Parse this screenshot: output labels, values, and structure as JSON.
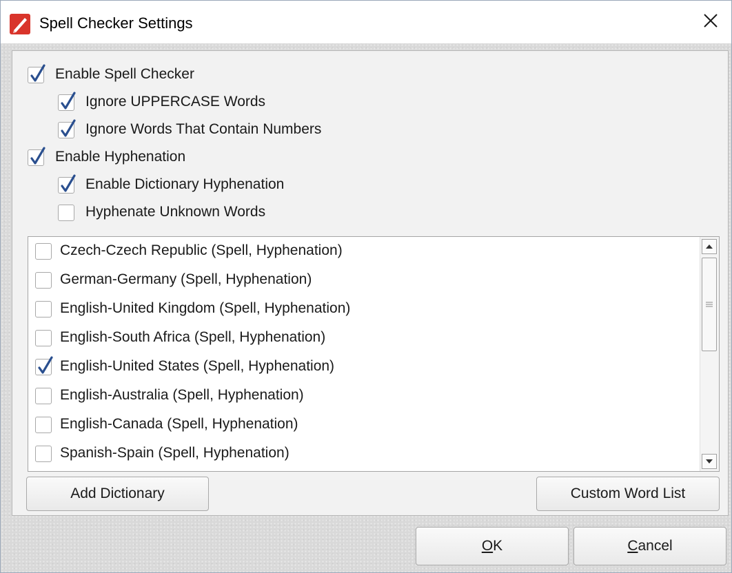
{
  "window": {
    "title": "Spell Checker Settings",
    "app_icon": "pdf-pen-icon",
    "close_icon": "close-icon"
  },
  "options": [
    {
      "label": "Enable Spell Checker",
      "checked": true
    },
    {
      "label": "Ignore UPPERCASE Words",
      "checked": true
    },
    {
      "label": "Ignore Words That Contain Numbers",
      "checked": true
    },
    {
      "label": "Enable Hyphenation",
      "checked": true
    },
    {
      "label": "Enable Dictionary Hyphenation",
      "checked": true
    },
    {
      "label": "Hyphenate Unknown Words",
      "checked": false
    }
  ],
  "languages": [
    {
      "label": "Czech-Czech Republic (Spell, Hyphenation)",
      "checked": false
    },
    {
      "label": "German-Germany (Spell, Hyphenation)",
      "checked": false
    },
    {
      "label": "English-United Kingdom (Spell, Hyphenation)",
      "checked": false
    },
    {
      "label": "English-South Africa (Spell, Hyphenation)",
      "checked": false
    },
    {
      "label": "English-United States (Spell, Hyphenation)",
      "checked": true
    },
    {
      "label": "English-Australia (Spell, Hyphenation)",
      "checked": false
    },
    {
      "label": "English-Canada (Spell, Hyphenation)",
      "checked": false
    },
    {
      "label": "Spanish-Spain (Spell, Hyphenation)",
      "checked": false
    }
  ],
  "buttons": {
    "add_dictionary": "Add Dictionary",
    "custom_word_list": "Custom Word List",
    "ok_mnemonic": "O",
    "ok_rest": "K",
    "cancel_mnemonic": "C",
    "cancel_rest": "ancel"
  },
  "colors": {
    "check_mark": "#2a4f8f",
    "icon_red": "#d9342b"
  }
}
